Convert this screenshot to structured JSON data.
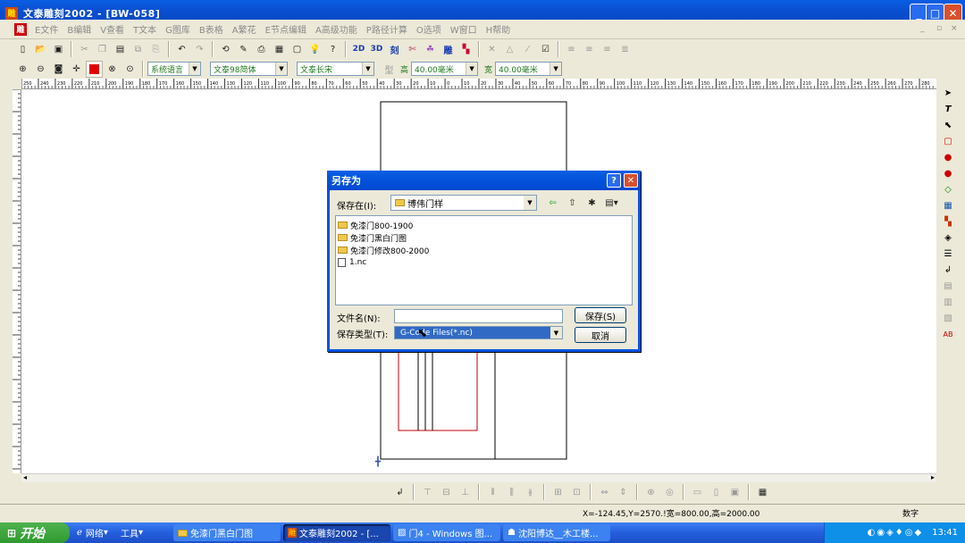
{
  "window": {
    "app_icon_text": "雕",
    "title": "文泰雕刻2002 - [BW-058]"
  },
  "menu": {
    "logo_text": "雕",
    "items": [
      "E文件",
      "B编辑",
      "V查看",
      "T文本",
      "G图库",
      "B表格",
      "A繁花",
      "E节点编辑",
      "A高级功能",
      "P路径计算",
      "O选项",
      "W窗口",
      "H帮助"
    ]
  },
  "toolbar2": {
    "language": "系统语言",
    "font_cn": "文泰98简体",
    "font_en": "文泰长宋",
    "type_label": "型",
    "height_label": "高",
    "height_value": "40.00毫米",
    "width_label": "宽",
    "width_value": "40.00毫米"
  },
  "toolbar1": {
    "mode_2d": "2D",
    "mode_3d": "3D",
    "mode_engrave": "刻",
    "diao": "雕"
  },
  "ruler": {
    "labels": [
      "250",
      "240",
      "230",
      "220",
      "210",
      "200",
      "190",
      "180",
      "170",
      "160",
      "150",
      "140",
      "130",
      "120",
      "110",
      "100",
      "90",
      "80",
      "70",
      "60",
      "50",
      "40",
      "30",
      "20",
      "10",
      "0",
      "10",
      "20",
      "30",
      "40",
      "50",
      "60",
      "70",
      "80",
      "90",
      "100",
      "110",
      "120",
      "130",
      "140",
      "150",
      "160",
      "170",
      "180",
      "190",
      "200",
      "210",
      "220",
      "230",
      "240",
      "250",
      "260",
      "270",
      "280"
    ]
  },
  "dialog": {
    "title": "另存为",
    "help": "?",
    "close": "✕",
    "save_in_label": "保存在(I):",
    "save_in_value": "博伟门样",
    "files": [
      {
        "name": "免漆门800-1900",
        "kind": "folder"
      },
      {
        "name": "免漆门黑白门图",
        "kind": "folder"
      },
      {
        "name": "免漆门修改800-2000",
        "kind": "folder"
      },
      {
        "name": "1.nc",
        "kind": "file"
      }
    ],
    "filename_label": "文件名(N):",
    "filename_value": "",
    "filetype_label": "保存类型(T):",
    "filetype_value": "G-Code Files(*.nc)",
    "save_button": "保存(S)",
    "cancel_button": "取消"
  },
  "status": {
    "coords": "X=-124.45,Y=2570.!宽=800.00,高=2000.00",
    "mode": "数字"
  },
  "taskbar": {
    "start": "开始",
    "network": "网络",
    "tools": "工具",
    "tasks": [
      "免漆门黑白门图",
      "文泰雕刻2002 - [...",
      "门4 - Windows 图...",
      "沈阳博达__木工楼..."
    ],
    "clock": "13:41"
  }
}
